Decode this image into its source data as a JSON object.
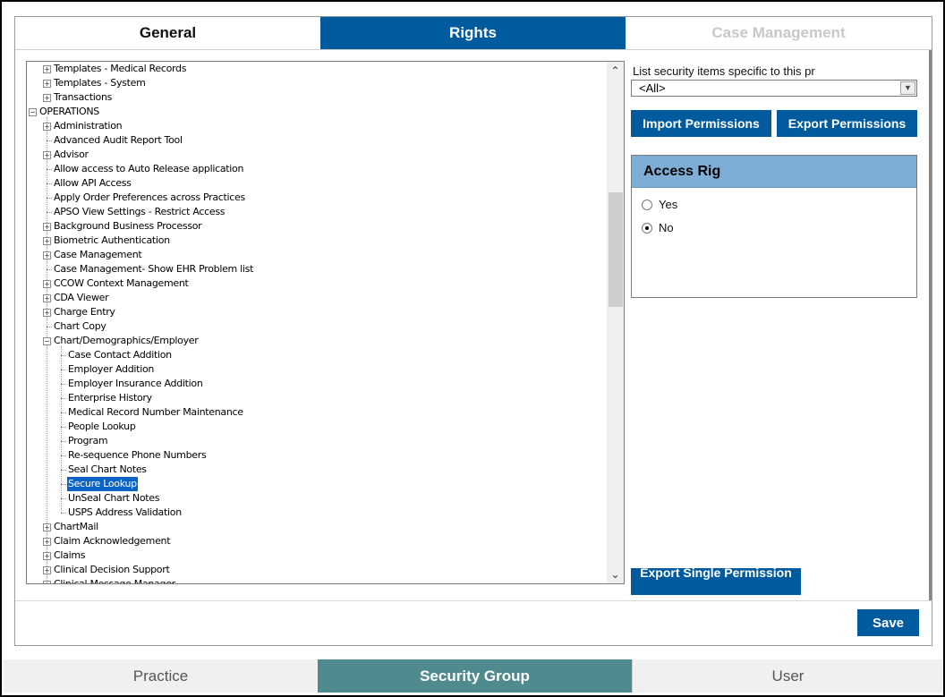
{
  "top_tabs": {
    "general": "General",
    "rights": "Rights",
    "case_management": "Case Management"
  },
  "tree": {
    "rows": [
      {
        "label": "Templates - Medical Records",
        "level": 1,
        "expander": "+"
      },
      {
        "label": "Templates - System",
        "level": 1,
        "expander": "+"
      },
      {
        "label": "Transactions",
        "level": 1,
        "expander": "+"
      },
      {
        "label": "OPERATIONS",
        "level": 0,
        "expander": "-"
      },
      {
        "label": "Administration",
        "level": 1,
        "expander": "+"
      },
      {
        "label": "Advanced Audit Report Tool",
        "level": 1,
        "expander": ""
      },
      {
        "label": "Advisor",
        "level": 1,
        "expander": "+"
      },
      {
        "label": "Allow access to Auto Release application",
        "level": 1,
        "expander": ""
      },
      {
        "label": "Allow API Access",
        "level": 1,
        "expander": ""
      },
      {
        "label": "Apply Order Preferences across Practices",
        "level": 1,
        "expander": ""
      },
      {
        "label": "APSO View Settings  - Restrict Access",
        "level": 1,
        "expander": ""
      },
      {
        "label": "Background Business Processor",
        "level": 1,
        "expander": "+"
      },
      {
        "label": "Biometric Authentication",
        "level": 1,
        "expander": "+"
      },
      {
        "label": "Case Management",
        "level": 1,
        "expander": "+"
      },
      {
        "label": "Case Management- Show EHR Problem list",
        "level": 1,
        "expander": ""
      },
      {
        "label": "CCOW Context Management",
        "level": 1,
        "expander": "+"
      },
      {
        "label": "CDA Viewer",
        "level": 1,
        "expander": "+"
      },
      {
        "label": "Charge Entry",
        "level": 1,
        "expander": "+"
      },
      {
        "label": "Chart Copy",
        "level": 1,
        "expander": ""
      },
      {
        "label": "Chart/Demographics/Employer",
        "level": 1,
        "expander": "-"
      },
      {
        "label": "Case Contact Addition",
        "level": 2,
        "expander": ""
      },
      {
        "label": "Employer Addition",
        "level": 2,
        "expander": ""
      },
      {
        "label": "Employer Insurance Addition",
        "level": 2,
        "expander": ""
      },
      {
        "label": "Enterprise History",
        "level": 2,
        "expander": ""
      },
      {
        "label": "Medical Record Number Maintenance",
        "level": 2,
        "expander": ""
      },
      {
        "label": "People Lookup",
        "level": 2,
        "expander": ""
      },
      {
        "label": "Program",
        "level": 2,
        "expander": ""
      },
      {
        "label": "Re-sequence Phone Numbers",
        "level": 2,
        "expander": ""
      },
      {
        "label": "Seal Chart Notes",
        "level": 2,
        "expander": ""
      },
      {
        "label": "Secure Lookup",
        "level": 2,
        "expander": "",
        "selected": true
      },
      {
        "label": "UnSeal Chart Notes",
        "level": 2,
        "expander": ""
      },
      {
        "label": "USPS Address Validation",
        "level": 2,
        "expander": ""
      },
      {
        "label": "ChartMail",
        "level": 1,
        "expander": "+"
      },
      {
        "label": "Claim Acknowledgement",
        "level": 1,
        "expander": "+"
      },
      {
        "label": "Claims",
        "level": 1,
        "expander": "+"
      },
      {
        "label": "Clinical Decision Support",
        "level": 1,
        "expander": "+"
      },
      {
        "label": "Clinical Message Manager",
        "level": 1,
        "expander": "+"
      }
    ],
    "scroll_up": "⌃",
    "scroll_down": "⌄"
  },
  "right": {
    "list_label": "List security items specific to this pr",
    "select_value": "<All>",
    "import_button": "Import Permissions",
    "export_button": "Export Permissions",
    "panel_title": "Access Rig",
    "radio_yes": "Yes",
    "radio_no": "No",
    "radio_selected": "No",
    "export_single": "Export Single Permission"
  },
  "save_button": "Save",
  "bottom_tabs": {
    "practice": "Practice",
    "security_group": "Security Group",
    "user": "User"
  },
  "colors": {
    "accent": "#005a9e",
    "selected_tab": "#4f8a8f",
    "panel_header": "#7eaed6"
  }
}
